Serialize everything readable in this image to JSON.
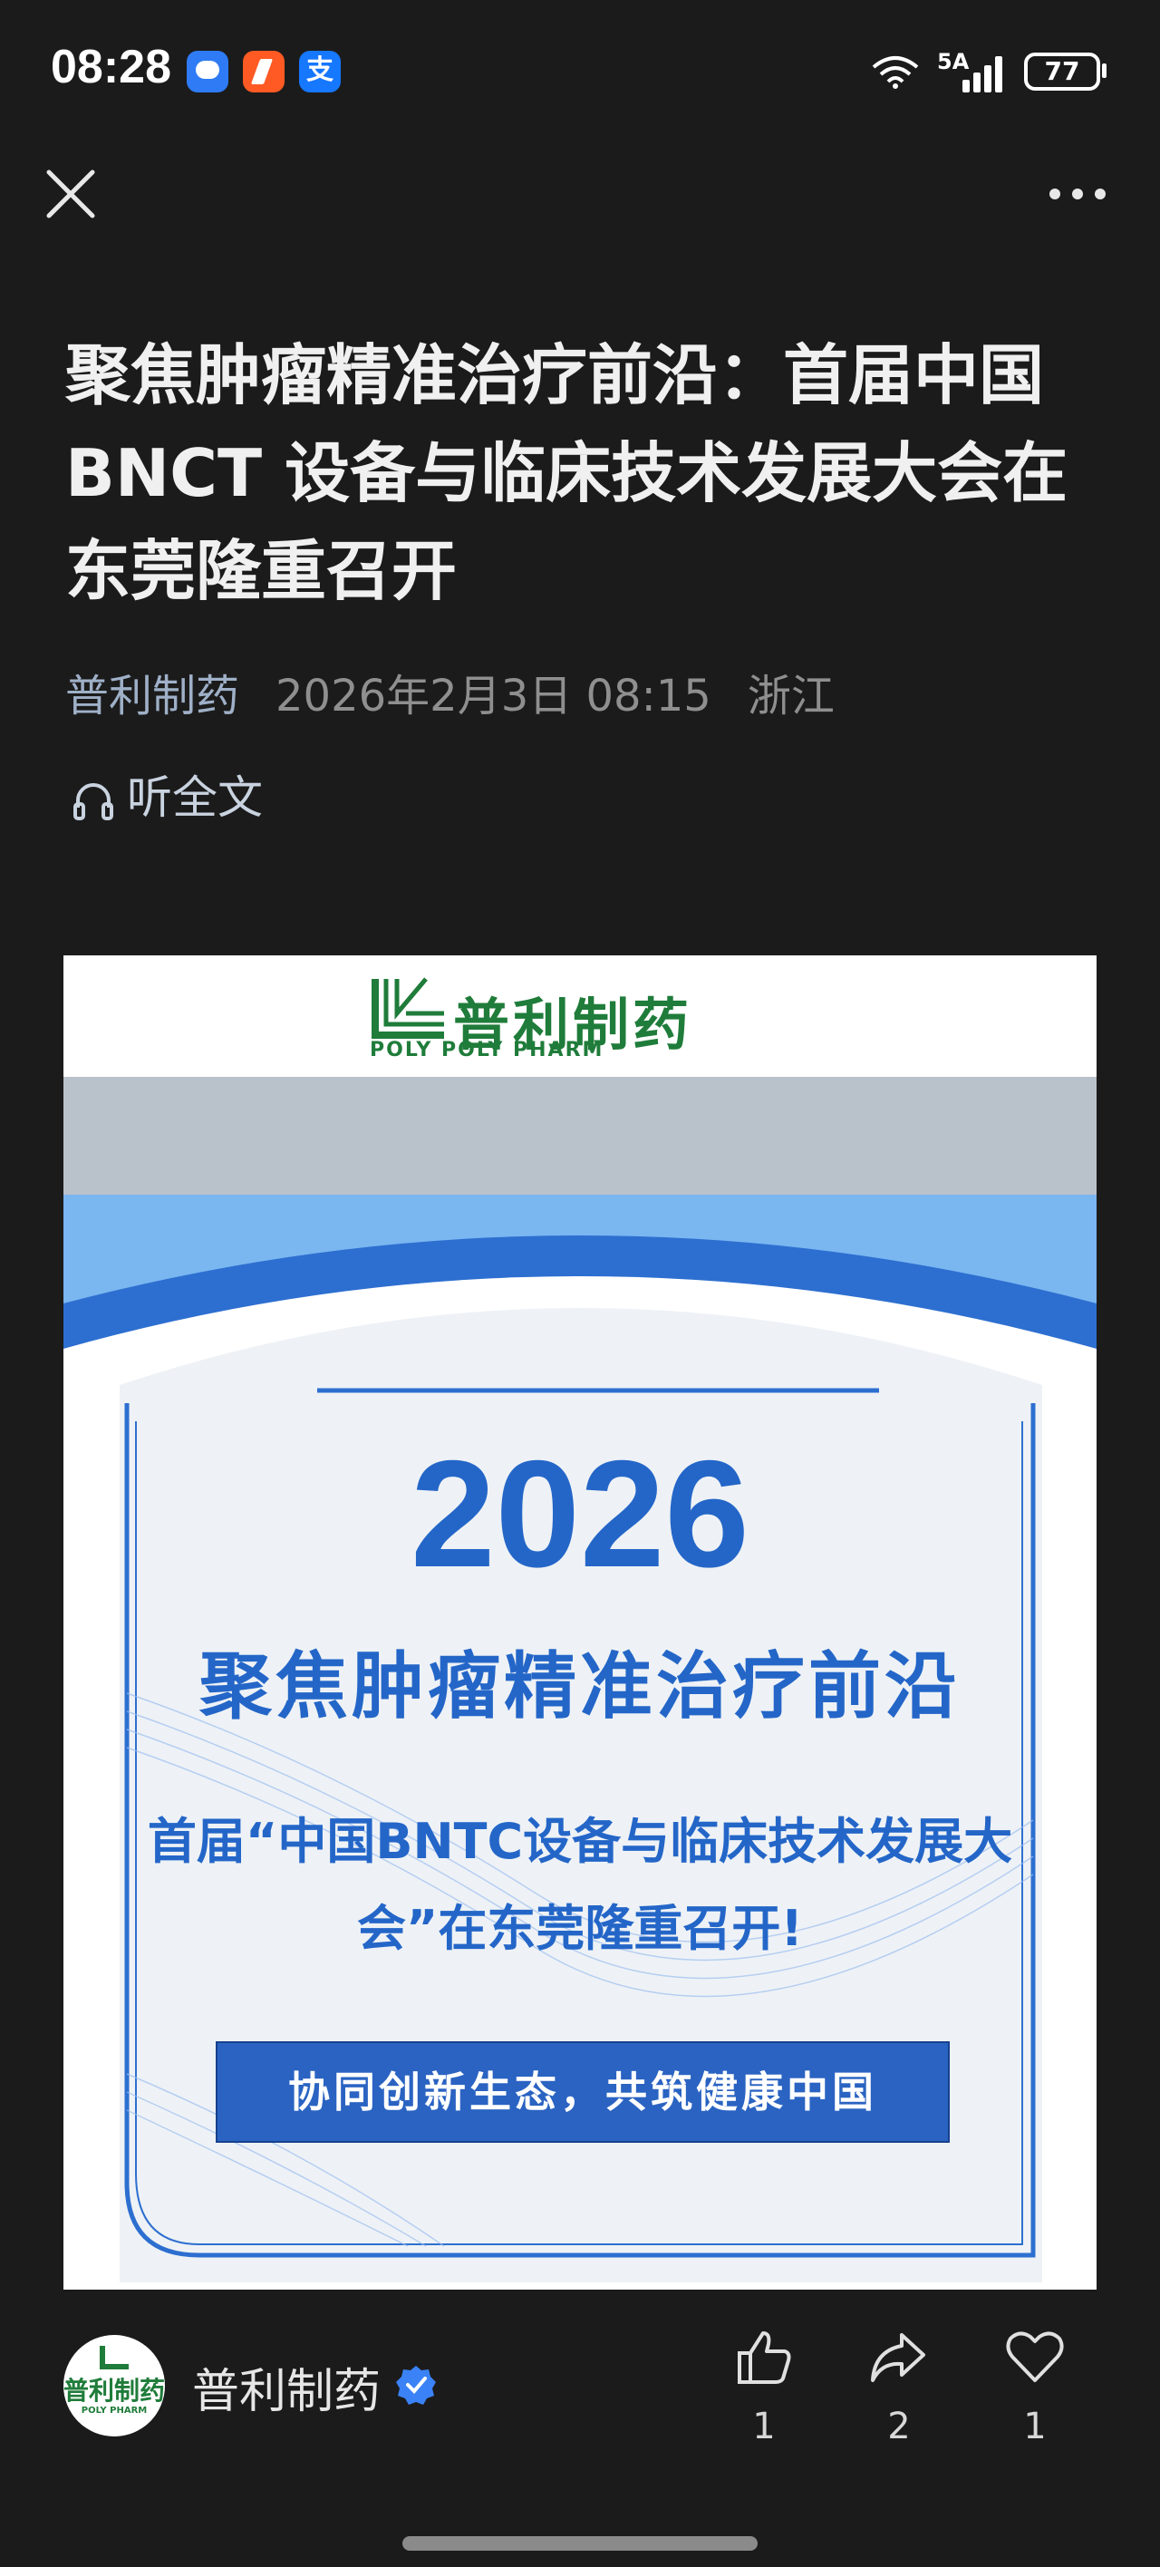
{
  "status_bar": {
    "time": "08:28",
    "network": "5A",
    "battery": "77",
    "app_icons": [
      "message-icon",
      "flame-app-icon",
      "alipay-icon"
    ],
    "alipay_glyph": "支"
  },
  "nav": {
    "close_icon": "close-icon",
    "more_icon": "more-icon"
  },
  "article": {
    "title": "聚焦肿瘤精准治疗前沿：首届中国 BNCT 设备与临床技术发展大会在东莞隆重召开",
    "author": "普利制药",
    "date": "2026年2月3日 08:15",
    "location": "浙江",
    "listen_label": "听全文"
  },
  "poster": {
    "logo_cn": "普利制药",
    "logo_en": "POLY POLY PHARM",
    "year": "2026",
    "headline": "聚焦肿瘤精准治疗前沿",
    "subheadline": "首届“中国BNTC设备与临床技术发展大会”在东莞隆重召开!",
    "slogan": "协同创新生态，共筑健康中国",
    "colors": {
      "primary_blue": "#2466c8",
      "light_blue": "#7ab6f0",
      "gray_bg": "#b9c2cb",
      "logo_green": "#1f7c3a"
    }
  },
  "footer": {
    "account_name": "普利制药",
    "avatar_cn": "普利制药",
    "avatar_en": "POLY PHARM",
    "like_count": "1",
    "share_count": "2",
    "favorite_count": "1"
  }
}
